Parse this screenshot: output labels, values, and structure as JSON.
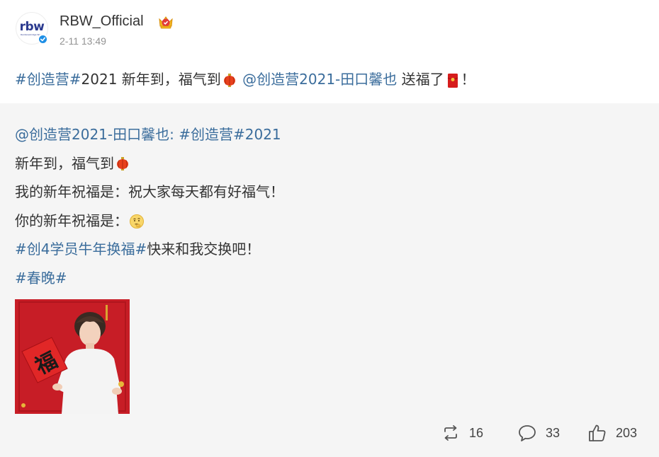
{
  "header": {
    "avatar_text": "rbw",
    "avatar_subtext": "Rainbowbridge World",
    "username": "RBW_Official",
    "timestamp": "2-11 13:49"
  },
  "post": {
    "hashtag1": "#创造营#",
    "text1": "2021 新年到，福气到",
    "mention": "@创造营2021-田口馨也",
    "text2": " 送福了",
    "text3": "！"
  },
  "repost": {
    "line1_mention": "@创造营2021-田口馨也",
    "line1_colon": ": ",
    "line1_hashtag": "#创造营#",
    "line1_text": "2021",
    "line2_text": "新年到，福气到",
    "line3_text": "我的新年祝福是：祝大家每天都有好福气！",
    "line4_text": "你的新年祝福是：",
    "line5_hashtag": "#创4学员牛年换福#",
    "line5_text": "快来和我交换吧！",
    "line6_hashtag": "#春晚#",
    "image_caption": "福"
  },
  "actions": {
    "repost_count": "16",
    "comment_count": "33",
    "like_count": "203"
  },
  "icons": {
    "verified": "verified-icon",
    "crown": "crown-badge-icon",
    "lantern": "lantern-emoji-icon",
    "red_envelope": "red-envelope-emoji-icon",
    "thinking": "thinking-emoji-icon",
    "repost": "repost-icon",
    "comment": "comment-icon",
    "like": "like-icon"
  },
  "colors": {
    "link": "#3b6d9c",
    "repost_bg": "#f5f5f5",
    "verified": "#1e8fe6"
  }
}
